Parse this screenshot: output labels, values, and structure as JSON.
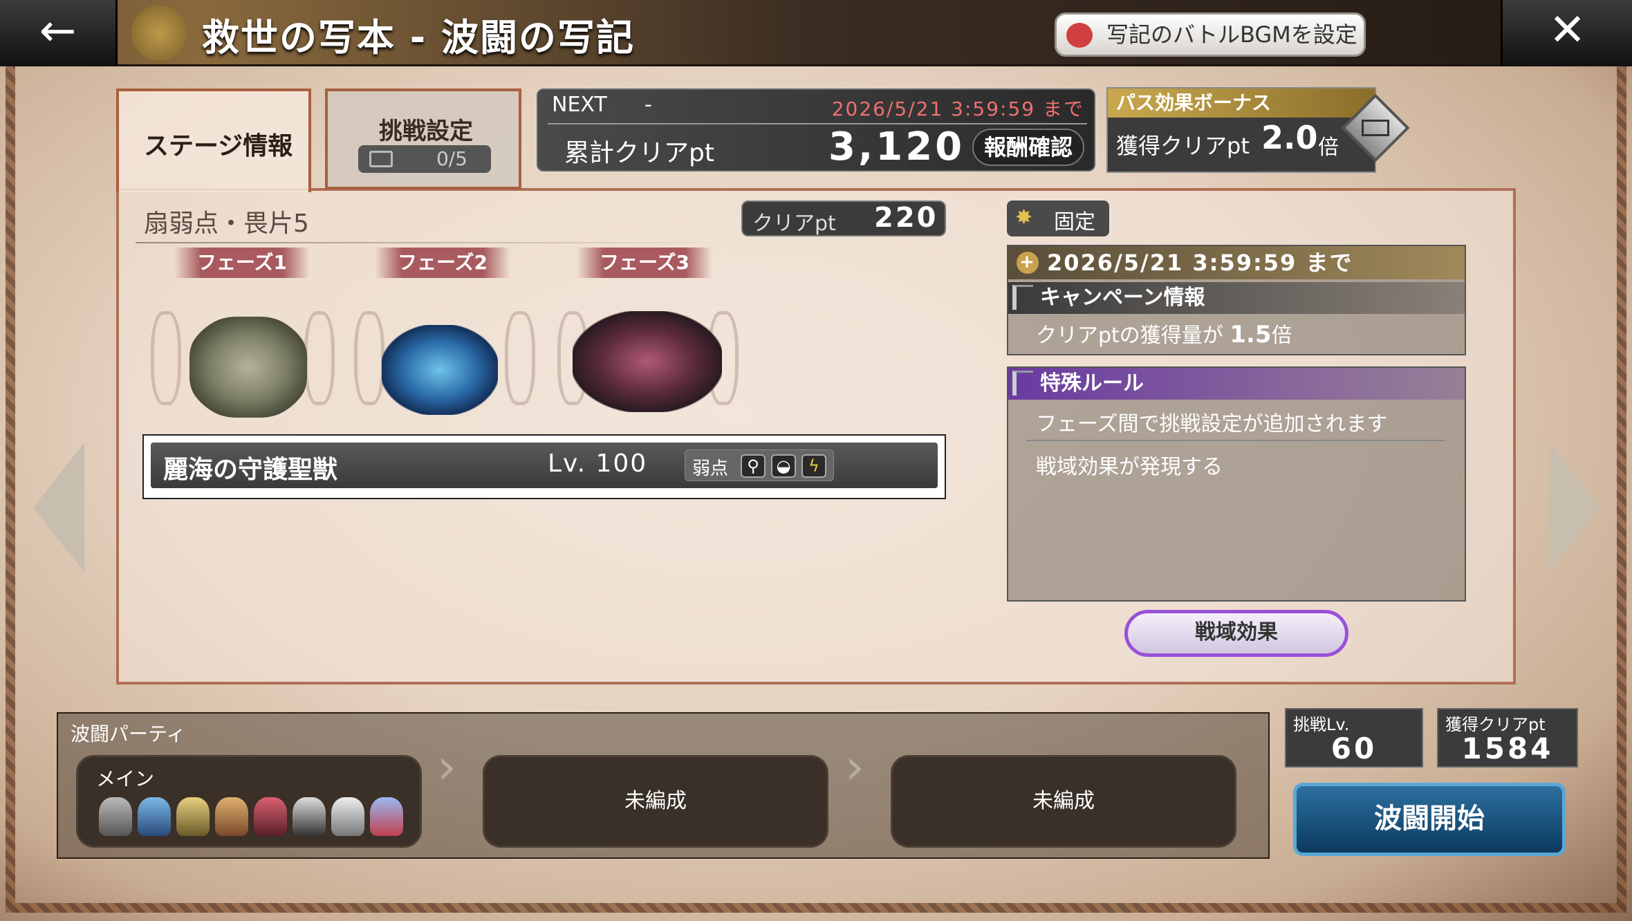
{
  "header": {
    "title": "救世の写本 - 波闘の写記",
    "bgm_button": "写記のバトルBGMを設定",
    "back_symbol": "←",
    "close_symbol": "✕"
  },
  "tabs": {
    "stage_info": "ステージ情報",
    "challenge_settings": "挑戦設定",
    "challenge_count": "0/5"
  },
  "next_panel": {
    "label": "NEXT",
    "dash": "-",
    "deadline": "2026/5/21 3:59:59 まで",
    "cumulative_label": "累計クリアpt",
    "cumulative_value": "3,120",
    "reward_button": "報酬確認"
  },
  "pass_bonus": {
    "title": "パス効果ボーナス",
    "label": "獲得クリアpt",
    "value": "2.0",
    "unit": "倍"
  },
  "stage": {
    "subtitle": "扇弱点・畏片5",
    "clear_pt_label": "クリアpt",
    "clear_pt_value": "220",
    "phases": [
      "フェーズ1",
      "フェーズ2",
      "フェーズ3"
    ],
    "monster_name": "麗海の守護聖獣",
    "monster_level": "Lv. 100",
    "weakness_label": "弱点",
    "weakness_icons": [
      "fan-icon",
      "shell-icon",
      "lightning-icon"
    ]
  },
  "campaign": {
    "fixed_label": "固定",
    "deadline": "2026/5/21  3:59:59 まで",
    "header": "キャンペーン情報",
    "body_prefix": "クリアptの獲得量が",
    "body_value": "1.5",
    "body_suffix": "倍"
  },
  "special_rules": {
    "header": "特殊ルール",
    "rules": [
      "フェーズ間で挑戦設定が追加されます",
      "戦域効果が発現する"
    ]
  },
  "field_effect_button": "戦域効果",
  "party": {
    "label": "波闘パーティ",
    "main_label": "メイン",
    "slot_2": "未編成",
    "slot_3": "未編成",
    "chevron": "›"
  },
  "challenge_lv": {
    "label": "挑戦Lv.",
    "value": "60"
  },
  "gain_pt": {
    "label": "獲得クリアpt",
    "value": "1584"
  },
  "start_button": "波闘開始",
  "colors": {
    "accent_purple": "#9a50d8",
    "deadline_red": "#f07070",
    "gold": "#c9a84f",
    "start_blue": "#2c6fa0"
  }
}
